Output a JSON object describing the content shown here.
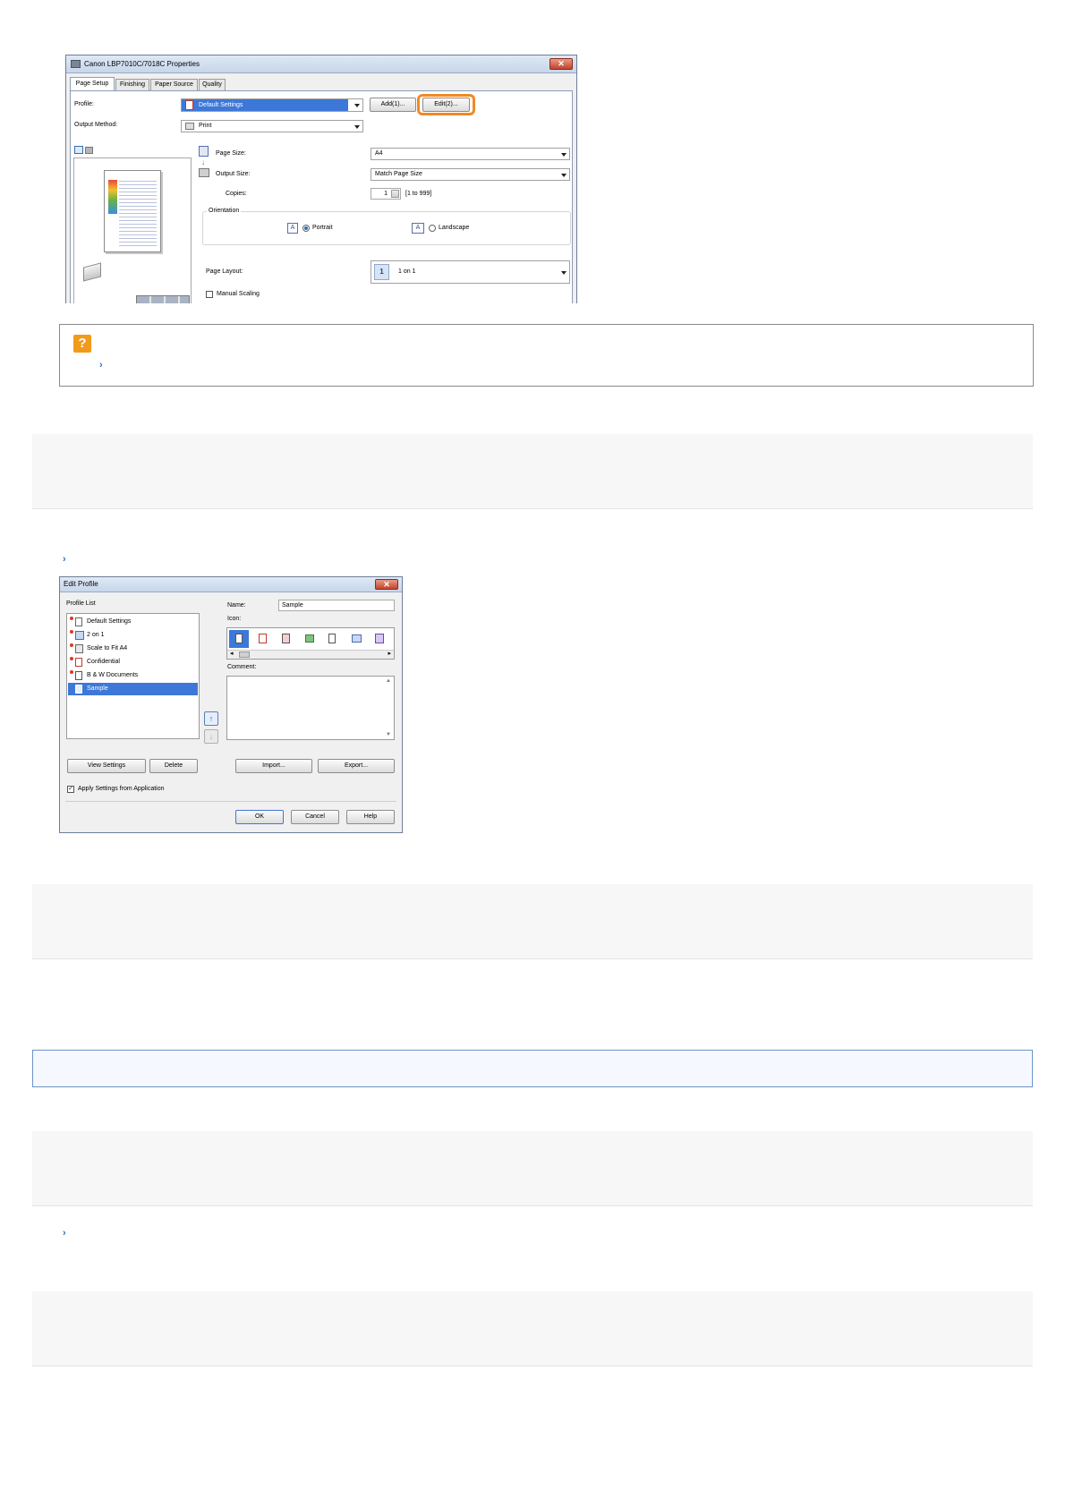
{
  "props_window": {
    "title": "Canon LBP7010C/7018C Properties",
    "tabs": [
      "Page Setup",
      "Finishing",
      "Paper Source",
      "Quality"
    ],
    "profile_label": "Profile:",
    "profile_value": "Default Settings",
    "add_button": "Add(1)...",
    "edit_button": "Edit(2)...",
    "output_method_label": "Output Method:",
    "output_method_value": "Print",
    "page_size_label": "Page Size:",
    "page_size_value": "A4",
    "output_size_label": "Output Size:",
    "output_size_value": "Match Page Size",
    "copies_label": "Copies:",
    "copies_value": "1",
    "copies_range": "[1 to 999]",
    "orientation_label": "Orientation",
    "portrait_label": "Portrait",
    "landscape_label": "Landscape",
    "page_layout_label": "Page Layout:",
    "page_layout_number": "1",
    "page_layout_value": "1 on 1",
    "manual_scaling_label": "Manual Scaling",
    "orientation_selected": "Portrait",
    "highlight_color": "#f08a24"
  },
  "edit_profile": {
    "title": "Edit Profile",
    "profile_list_label": "Profile List",
    "profiles": [
      "Default Settings",
      "2 on 1",
      "Scale to Fit A4",
      "Confidential",
      "B & W Documents",
      "Sample"
    ],
    "selected_profile": "Sample",
    "name_label": "Name:",
    "name_value": "Sample",
    "icon_label": "Icon:",
    "comment_label": "Comment:",
    "view_settings_button": "View Settings",
    "delete_button": "Delete",
    "import_button": "Import...",
    "export_button": "Export...",
    "apply_settings_label": "Apply Settings from Application",
    "apply_settings_checked": true,
    "ok_button": "OK",
    "cancel_button": "Cancel",
    "help_button": "Help"
  },
  "colors": {
    "selection_blue": "#3d78d8",
    "help_icon_orange": "#f29a1a",
    "bullet_blue": "#2f6fb7",
    "info_box_border": "#6b93c9",
    "info_box_bg": "#f5f9ff"
  },
  "icons": {
    "help": "question-mark-icon",
    "bullet": "arrow-bullet-icon"
  }
}
